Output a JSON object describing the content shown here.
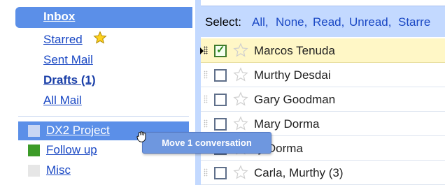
{
  "nav": {
    "inbox": "Inbox",
    "starred": "Starred",
    "sent": "Sent Mail",
    "drafts": "Drafts (1)",
    "all": "All Mail"
  },
  "labels": [
    {
      "name": "DX2 Project",
      "color": "#c8d6f4",
      "text_color": "#ffffff",
      "dragging": true
    },
    {
      "name": "Follow up",
      "color": "#3c9b28",
      "text_color": "#1a48c4",
      "dragging": false
    },
    {
      "name": "Misc",
      "color": "#e6e6e6",
      "text_color": "#1a48c4",
      "dragging": false
    }
  ],
  "select_bar": {
    "label": "Select:",
    "options": [
      "All,",
      "None,",
      "Read,",
      "Unread,",
      "Starre"
    ]
  },
  "messages": [
    {
      "sender": "Marcos Tenuda",
      "checked": true,
      "selected": true
    },
    {
      "sender": "Murthy Desdai",
      "checked": false,
      "selected": false
    },
    {
      "sender": "Gary Goodman",
      "checked": false,
      "selected": false
    },
    {
      "sender": "Mary Dorma",
      "checked": false,
      "selected": false
    },
    {
      "sender": "ry Dorma",
      "checked": false,
      "selected": false
    },
    {
      "sender": "Carla, Murthy (3)",
      "checked": false,
      "selected": false
    }
  ],
  "drag_tooltip": "Move 1 conversation",
  "colors": {
    "accent": "#5b8fe8",
    "pane": "#c3d9ff",
    "link": "#1a48c4",
    "selected_row": "#fff7c6"
  },
  "icons": {
    "star": "star-icon",
    "hand": "grab-hand-icon"
  }
}
